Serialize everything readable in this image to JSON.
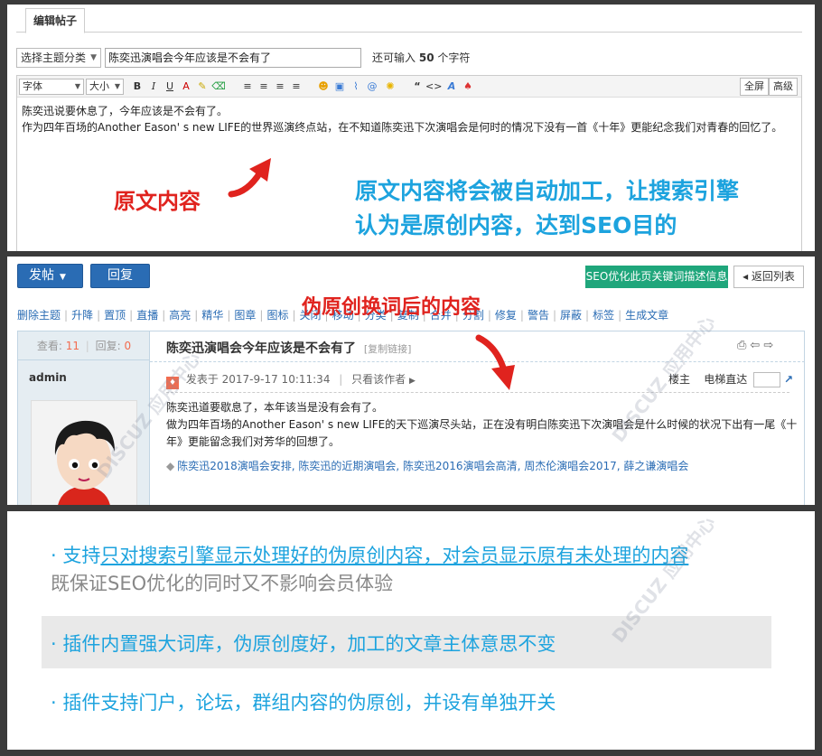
{
  "editor": {
    "tab_label": "编辑帖子",
    "topic_select": "选择主题分类",
    "title_value": "陈奕迅演唱会今年应该是不会有了",
    "char_hint_prefix": "还可输入",
    "char_count": "50",
    "char_hint_suffix": "个字符",
    "font_select": "字体",
    "size_select": "大小",
    "fullscreen_label": "全屏",
    "advanced_label": "高级",
    "content_line1": "陈奕迅说要休息了，今年应该是不会有了。",
    "content_line2": "作为四年百场的Another Eason' s new LIFE的世界巡演终点站，在不知道陈奕迅下次演唱会是何时的情况下没有一首《十年》更能纪念我们对青春的回忆了。"
  },
  "annotations": {
    "original_label": "原文内容",
    "processed_line1": "原文内容将会被自动加工，让搜索引擎",
    "processed_line2": "认为是原创内容，达到SEO目的",
    "rewritten_label": "伪原创换词后的内容"
  },
  "forum": {
    "post_button": "发帖",
    "reply_button": "回复",
    "seo_button": "SEO优化此页关键词描述信息",
    "back_button": "返回列表",
    "actions": [
      "删除主题",
      "升降",
      "置顶",
      "直播",
      "高亮",
      "精华",
      "图章",
      "图标",
      "关闭",
      "移动",
      "分类",
      "复制",
      "合并",
      "分割",
      "修复",
      "警告",
      "屏蔽",
      "标签",
      "生成文章"
    ],
    "views_label": "查看:",
    "views": "11",
    "replies_label": "回复:",
    "replies": "0",
    "thread_title": "陈奕迅演唱会今年应该是不会有了",
    "copy_link": "[复制链接]",
    "author": "admin",
    "posted_at": "发表于 2017-9-17 10:11:34",
    "only_author": "只看该作者",
    "floor": "楼主",
    "elevator": "电梯直达",
    "body_line1": "陈奕迅道要歇息了，本年该当是没有会有了。",
    "body_line2": "做为四年百场的Another Eason' s new LIFE的天下巡演尽头站，正在没有明白陈奕迅下次演唱会是什么时候的状况下出有一尾《十年》更能留念我们对芳华的回想了。",
    "tags": "陈奕迅2018演唱会安排, 陈奕迅的近期演唱会, 陈奕迅2016演唱会高清, 周杰伦演唱会2017, 薛之谦演唱会"
  },
  "features": {
    "f1_prefix": "· 支持",
    "f1_underlined": "只对搜索引擎显示处理好的伪原创内容，对会员显示原有未处理的内容",
    "f1_sub": "既保证SEO优化的同时又不影响会员体验",
    "f2": "· 插件内置强大词库，伪原创度好，加工的文章主体意思不变",
    "f3": "· 插件支持门户，论坛，群组内容的伪原创，并设有单独开关"
  },
  "colors": {
    "red": "#e0231e",
    "blue": "#1da3de",
    "forum_blue": "#2a6cb4",
    "seo_green": "#1fa67b"
  }
}
